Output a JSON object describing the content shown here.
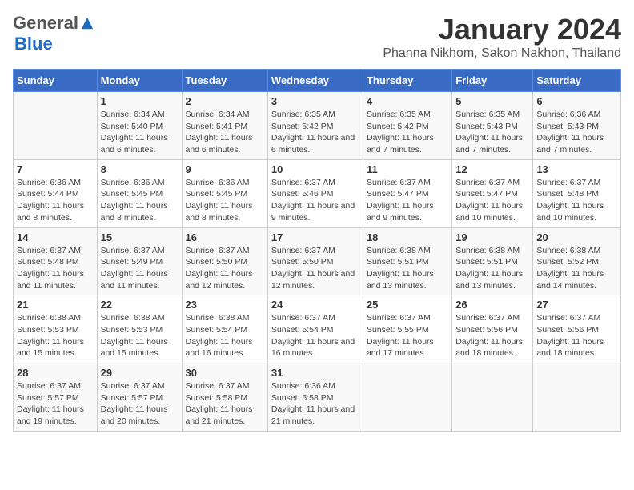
{
  "logo": {
    "general": "General",
    "blue": "Blue"
  },
  "title": "January 2024",
  "subtitle": "Phanna Nikhom, Sakon Nakhon, Thailand",
  "headers": [
    "Sunday",
    "Monday",
    "Tuesday",
    "Wednesday",
    "Thursday",
    "Friday",
    "Saturday"
  ],
  "weeks": [
    [
      {
        "day": "",
        "sunrise": "",
        "sunset": "",
        "daylight": ""
      },
      {
        "day": "1",
        "sunrise": "Sunrise: 6:34 AM",
        "sunset": "Sunset: 5:40 PM",
        "daylight": "Daylight: 11 hours and 6 minutes."
      },
      {
        "day": "2",
        "sunrise": "Sunrise: 6:34 AM",
        "sunset": "Sunset: 5:41 PM",
        "daylight": "Daylight: 11 hours and 6 minutes."
      },
      {
        "day": "3",
        "sunrise": "Sunrise: 6:35 AM",
        "sunset": "Sunset: 5:42 PM",
        "daylight": "Daylight: 11 hours and 6 minutes."
      },
      {
        "day": "4",
        "sunrise": "Sunrise: 6:35 AM",
        "sunset": "Sunset: 5:42 PM",
        "daylight": "Daylight: 11 hours and 7 minutes."
      },
      {
        "day": "5",
        "sunrise": "Sunrise: 6:35 AM",
        "sunset": "Sunset: 5:43 PM",
        "daylight": "Daylight: 11 hours and 7 minutes."
      },
      {
        "day": "6",
        "sunrise": "Sunrise: 6:36 AM",
        "sunset": "Sunset: 5:43 PM",
        "daylight": "Daylight: 11 hours and 7 minutes."
      }
    ],
    [
      {
        "day": "7",
        "sunrise": "Sunrise: 6:36 AM",
        "sunset": "Sunset: 5:44 PM",
        "daylight": "Daylight: 11 hours and 8 minutes."
      },
      {
        "day": "8",
        "sunrise": "Sunrise: 6:36 AM",
        "sunset": "Sunset: 5:45 PM",
        "daylight": "Daylight: 11 hours and 8 minutes."
      },
      {
        "day": "9",
        "sunrise": "Sunrise: 6:36 AM",
        "sunset": "Sunset: 5:45 PM",
        "daylight": "Daylight: 11 hours and 8 minutes."
      },
      {
        "day": "10",
        "sunrise": "Sunrise: 6:37 AM",
        "sunset": "Sunset: 5:46 PM",
        "daylight": "Daylight: 11 hours and 9 minutes."
      },
      {
        "day": "11",
        "sunrise": "Sunrise: 6:37 AM",
        "sunset": "Sunset: 5:47 PM",
        "daylight": "Daylight: 11 hours and 9 minutes."
      },
      {
        "day": "12",
        "sunrise": "Sunrise: 6:37 AM",
        "sunset": "Sunset: 5:47 PM",
        "daylight": "Daylight: 11 hours and 10 minutes."
      },
      {
        "day": "13",
        "sunrise": "Sunrise: 6:37 AM",
        "sunset": "Sunset: 5:48 PM",
        "daylight": "Daylight: 11 hours and 10 minutes."
      }
    ],
    [
      {
        "day": "14",
        "sunrise": "Sunrise: 6:37 AM",
        "sunset": "Sunset: 5:48 PM",
        "daylight": "Daylight: 11 hours and 11 minutes."
      },
      {
        "day": "15",
        "sunrise": "Sunrise: 6:37 AM",
        "sunset": "Sunset: 5:49 PM",
        "daylight": "Daylight: 11 hours and 11 minutes."
      },
      {
        "day": "16",
        "sunrise": "Sunrise: 6:37 AM",
        "sunset": "Sunset: 5:50 PM",
        "daylight": "Daylight: 11 hours and 12 minutes."
      },
      {
        "day": "17",
        "sunrise": "Sunrise: 6:37 AM",
        "sunset": "Sunset: 5:50 PM",
        "daylight": "Daylight: 11 hours and 12 minutes."
      },
      {
        "day": "18",
        "sunrise": "Sunrise: 6:38 AM",
        "sunset": "Sunset: 5:51 PM",
        "daylight": "Daylight: 11 hours and 13 minutes."
      },
      {
        "day": "19",
        "sunrise": "Sunrise: 6:38 AM",
        "sunset": "Sunset: 5:51 PM",
        "daylight": "Daylight: 11 hours and 13 minutes."
      },
      {
        "day": "20",
        "sunrise": "Sunrise: 6:38 AM",
        "sunset": "Sunset: 5:52 PM",
        "daylight": "Daylight: 11 hours and 14 minutes."
      }
    ],
    [
      {
        "day": "21",
        "sunrise": "Sunrise: 6:38 AM",
        "sunset": "Sunset: 5:53 PM",
        "daylight": "Daylight: 11 hours and 15 minutes."
      },
      {
        "day": "22",
        "sunrise": "Sunrise: 6:38 AM",
        "sunset": "Sunset: 5:53 PM",
        "daylight": "Daylight: 11 hours and 15 minutes."
      },
      {
        "day": "23",
        "sunrise": "Sunrise: 6:38 AM",
        "sunset": "Sunset: 5:54 PM",
        "daylight": "Daylight: 11 hours and 16 minutes."
      },
      {
        "day": "24",
        "sunrise": "Sunrise: 6:37 AM",
        "sunset": "Sunset: 5:54 PM",
        "daylight": "Daylight: 11 hours and 16 minutes."
      },
      {
        "day": "25",
        "sunrise": "Sunrise: 6:37 AM",
        "sunset": "Sunset: 5:55 PM",
        "daylight": "Daylight: 11 hours and 17 minutes."
      },
      {
        "day": "26",
        "sunrise": "Sunrise: 6:37 AM",
        "sunset": "Sunset: 5:56 PM",
        "daylight": "Daylight: 11 hours and 18 minutes."
      },
      {
        "day": "27",
        "sunrise": "Sunrise: 6:37 AM",
        "sunset": "Sunset: 5:56 PM",
        "daylight": "Daylight: 11 hours and 18 minutes."
      }
    ],
    [
      {
        "day": "28",
        "sunrise": "Sunrise: 6:37 AM",
        "sunset": "Sunset: 5:57 PM",
        "daylight": "Daylight: 11 hours and 19 minutes."
      },
      {
        "day": "29",
        "sunrise": "Sunrise: 6:37 AM",
        "sunset": "Sunset: 5:57 PM",
        "daylight": "Daylight: 11 hours and 20 minutes."
      },
      {
        "day": "30",
        "sunrise": "Sunrise: 6:37 AM",
        "sunset": "Sunset: 5:58 PM",
        "daylight": "Daylight: 11 hours and 21 minutes."
      },
      {
        "day": "31",
        "sunrise": "Sunrise: 6:36 AM",
        "sunset": "Sunset: 5:58 PM",
        "daylight": "Daylight: 11 hours and 21 minutes."
      },
      {
        "day": "",
        "sunrise": "",
        "sunset": "",
        "daylight": ""
      },
      {
        "day": "",
        "sunrise": "",
        "sunset": "",
        "daylight": ""
      },
      {
        "day": "",
        "sunrise": "",
        "sunset": "",
        "daylight": ""
      }
    ]
  ]
}
